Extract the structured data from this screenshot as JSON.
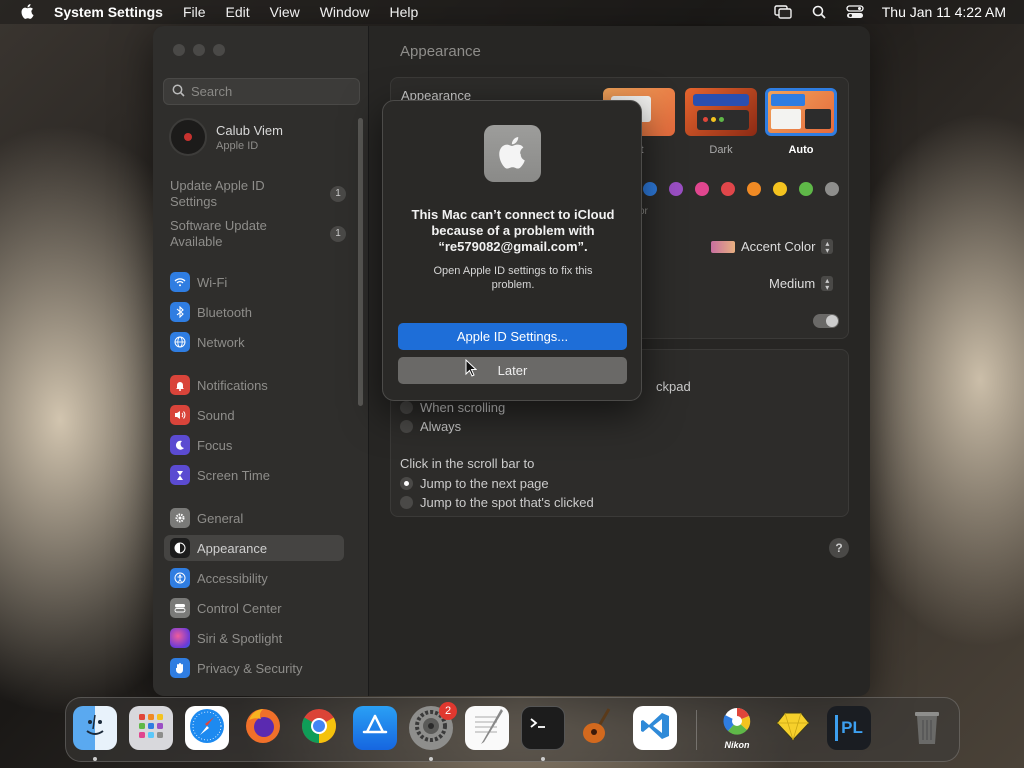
{
  "menubar": {
    "app_name": "System Settings",
    "items": [
      "File",
      "Edit",
      "View",
      "Window",
      "Help"
    ],
    "clock": "Thu Jan 11  4:22 AM"
  },
  "sidebar": {
    "search_placeholder": "Search",
    "profile": {
      "name": "Calub Viem",
      "subtitle": "Apple ID"
    },
    "notices": [
      {
        "label": "Update Apple ID Settings",
        "count": "1"
      },
      {
        "label": "Software Update Available",
        "count": "1"
      }
    ],
    "items": [
      {
        "label": "Wi-Fi",
        "icon": "wifi-icon",
        "color": "#2f7de1"
      },
      {
        "label": "Bluetooth",
        "icon": "bluetooth-icon",
        "color": "#2f7de1"
      },
      {
        "label": "Network",
        "icon": "globe-icon",
        "color": "#2f7de1"
      },
      {
        "label": "Notifications",
        "icon": "bell-icon",
        "color": "#d9443a"
      },
      {
        "label": "Sound",
        "icon": "speaker-icon",
        "color": "#d9443a"
      },
      {
        "label": "Focus",
        "icon": "moon-icon",
        "color": "#5b4bd1"
      },
      {
        "label": "Screen Time",
        "icon": "hourglass-icon",
        "color": "#5b4bd1"
      },
      {
        "label": "General",
        "icon": "gear-icon",
        "color": "#7a7a78"
      },
      {
        "label": "Appearance",
        "icon": "appearance-icon",
        "color": "#1c1c1c"
      },
      {
        "label": "Accessibility",
        "icon": "accessibility-icon",
        "color": "#2f7de1"
      },
      {
        "label": "Control Center",
        "icon": "control-center-icon",
        "color": "#7a7a78"
      },
      {
        "label": "Siri & Spotlight",
        "icon": "siri-icon",
        "color": "#b33ec9"
      },
      {
        "label": "Privacy & Security",
        "icon": "hand-icon",
        "color": "#2f7de1"
      }
    ]
  },
  "content": {
    "title": "Appearance",
    "appearance_label": "Appearance",
    "appearance_options": [
      {
        "label": "Light",
        "visible_text": "nt"
      },
      {
        "label": "Dark",
        "visible_text": "Dark"
      },
      {
        "label": "Auto",
        "visible_text": "Auto"
      }
    ],
    "accent_colors": [
      "#2f7de1",
      "#9b4fc4",
      "#e0468f",
      "#e0464a",
      "#f08a24",
      "#f4c31f",
      "#5fb848",
      "#8e8e8c"
    ],
    "accent_partial_text": "or",
    "accent_color_popup": "Accent Color",
    "sidebar_size_value": "Medium",
    "scroll_partial_text": "ckpad",
    "scroll_options": [
      "When scrolling",
      "Always"
    ],
    "click_scrollbar_label": "Click in the scroll bar to",
    "click_options": [
      {
        "label": "Jump to the next page",
        "checked": true
      },
      {
        "label": "Jump to the spot that's clicked",
        "checked": false
      }
    ],
    "help": "?"
  },
  "alert": {
    "title": "This Mac can’t connect to iCloud because of a problem with “re579082@gmail.com”.",
    "message": "Open Apple ID settings to fix this problem.",
    "primary_button": "Apple ID Settings...",
    "secondary_button": "Later"
  },
  "dock": {
    "apps": [
      {
        "name": "Finder",
        "icon": "finder-icon"
      },
      {
        "name": "Launchpad",
        "icon": "launchpad-icon"
      },
      {
        "name": "Safari",
        "icon": "safari-icon"
      },
      {
        "name": "Firefox",
        "icon": "firefox-icon"
      },
      {
        "name": "Chrome",
        "icon": "chrome-icon"
      },
      {
        "name": "App Store",
        "icon": "app-store-icon"
      },
      {
        "name": "System Settings",
        "icon": "system-settings-icon",
        "badge": "2"
      },
      {
        "name": "TextEdit",
        "icon": "textedit-icon"
      },
      {
        "name": "Terminal",
        "icon": "terminal-icon"
      },
      {
        "name": "GarageBand",
        "icon": "garageband-icon"
      },
      {
        "name": "VS Code",
        "icon": "vscode-icon"
      },
      {
        "name": "Nikon",
        "icon": "nikon-icon",
        "label": "Nikon"
      },
      {
        "name": "Sketch",
        "icon": "sketch-icon"
      },
      {
        "name": "PhotoLab",
        "icon": "photolab-icon",
        "label": "PL"
      },
      {
        "name": "Trash",
        "icon": "trash-icon"
      }
    ]
  }
}
